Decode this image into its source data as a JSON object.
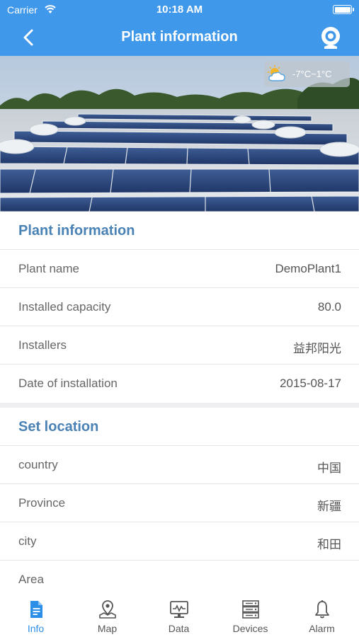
{
  "status_bar": {
    "carrier": "Carrier",
    "time": "10:18 AM"
  },
  "nav": {
    "title": "Plant information",
    "back_icon": "chevron-left-icon",
    "action_icon": "camera-icon"
  },
  "banner": {
    "weather": {
      "icon": "partly-cloudy-icon",
      "temperature": "-7°C~1°C"
    }
  },
  "plant_info": {
    "heading": "Plant information",
    "rows": [
      {
        "label": "Plant name",
        "value": "DemoPlant1"
      },
      {
        "label": "Installed capacity",
        "value": "80.0"
      },
      {
        "label": "Installers",
        "value": "益邦阳光"
      },
      {
        "label": "Date of installation",
        "value": "2015-08-17"
      }
    ]
  },
  "location": {
    "heading": "Set location",
    "rows": [
      {
        "label": "country",
        "value": "中国"
      },
      {
        "label": "Province",
        "value": "新疆"
      },
      {
        "label": "city",
        "value": "和田"
      },
      {
        "label": "Area",
        "value": ""
      }
    ]
  },
  "tabs": [
    {
      "label": "Info",
      "icon": "document-icon",
      "active": true
    },
    {
      "label": "Map",
      "icon": "map-pin-icon",
      "active": false
    },
    {
      "label": "Data",
      "icon": "monitor-chart-icon",
      "active": false
    },
    {
      "label": "Devices",
      "icon": "server-icon",
      "active": false
    },
    {
      "label": "Alarm",
      "icon": "bell-icon",
      "active": false
    }
  ],
  "colors": {
    "primary": "#3f98ea",
    "section_heading": "#4a82b5",
    "tab_active": "#2b8fe8"
  }
}
